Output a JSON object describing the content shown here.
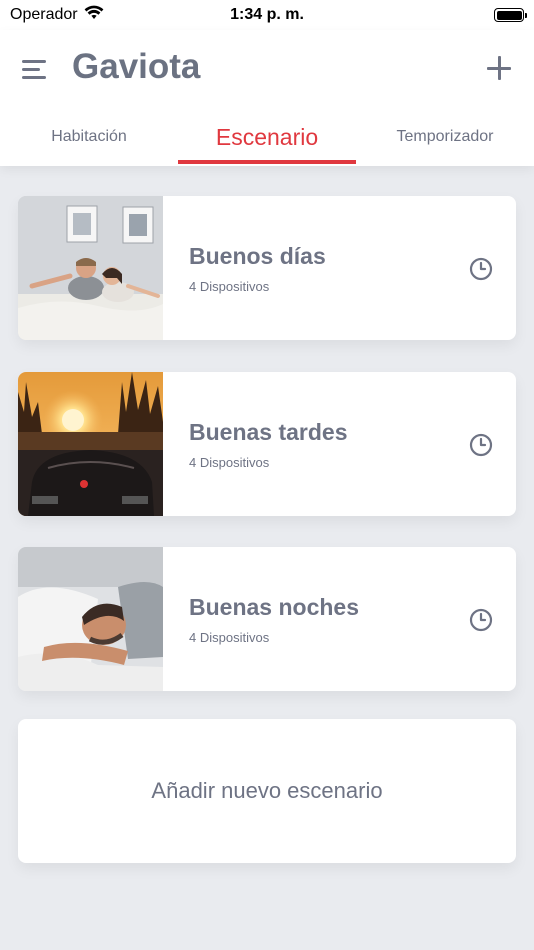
{
  "status_bar": {
    "carrier": "Operador",
    "time": "1:34 p. m."
  },
  "header": {
    "title": "Gaviota"
  },
  "tabs": [
    {
      "label": "Habitación",
      "active": false
    },
    {
      "label": "Escenario",
      "active": true
    },
    {
      "label": "Temporizador",
      "active": false
    }
  ],
  "scenes": [
    {
      "title": "Buenos días",
      "devices": "4 Dispositivos",
      "image": "couple-waking-up-photo"
    },
    {
      "title": "Buenas tardes",
      "devices": "4 Dispositivos",
      "image": "sunset-road-car-photo"
    },
    {
      "title": "Buenas noches",
      "devices": "4 Dispositivos",
      "image": "man-sleeping-photo"
    }
  ],
  "add_scene_label": "Añadir nuevo escenario",
  "icons": {
    "menu": "hamburger-menu-icon",
    "add": "plus-icon",
    "schedule": "clock-icon",
    "wifi": "wifi-icon",
    "battery": "battery-icon"
  },
  "colors": {
    "accent": "#e0383f",
    "text_muted": "#6e7384",
    "background": "#e9ebef",
    "card": "#ffffff"
  }
}
